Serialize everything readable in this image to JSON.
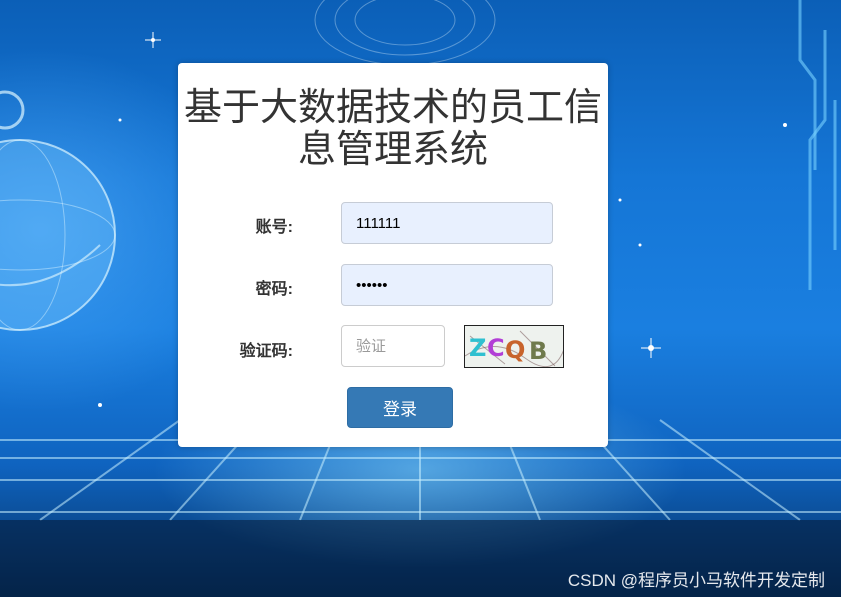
{
  "page": {
    "title_line1": "基于大数据技术的员工信",
    "title_line2": "息管理系统"
  },
  "form": {
    "account_label": "账号:",
    "account_value": "111111",
    "password_label": "密码:",
    "password_value": "111111",
    "captcha_label": "验证码:",
    "captcha_placeholder": "验证",
    "captcha_text": "ZCQB",
    "login_label": "登录"
  },
  "watermark": "CSDN @程序员小马软件开发定制",
  "colors": {
    "accent": "#3579b5",
    "input_autofill": "#e8f0fe",
    "background": "#1a7fe0"
  }
}
